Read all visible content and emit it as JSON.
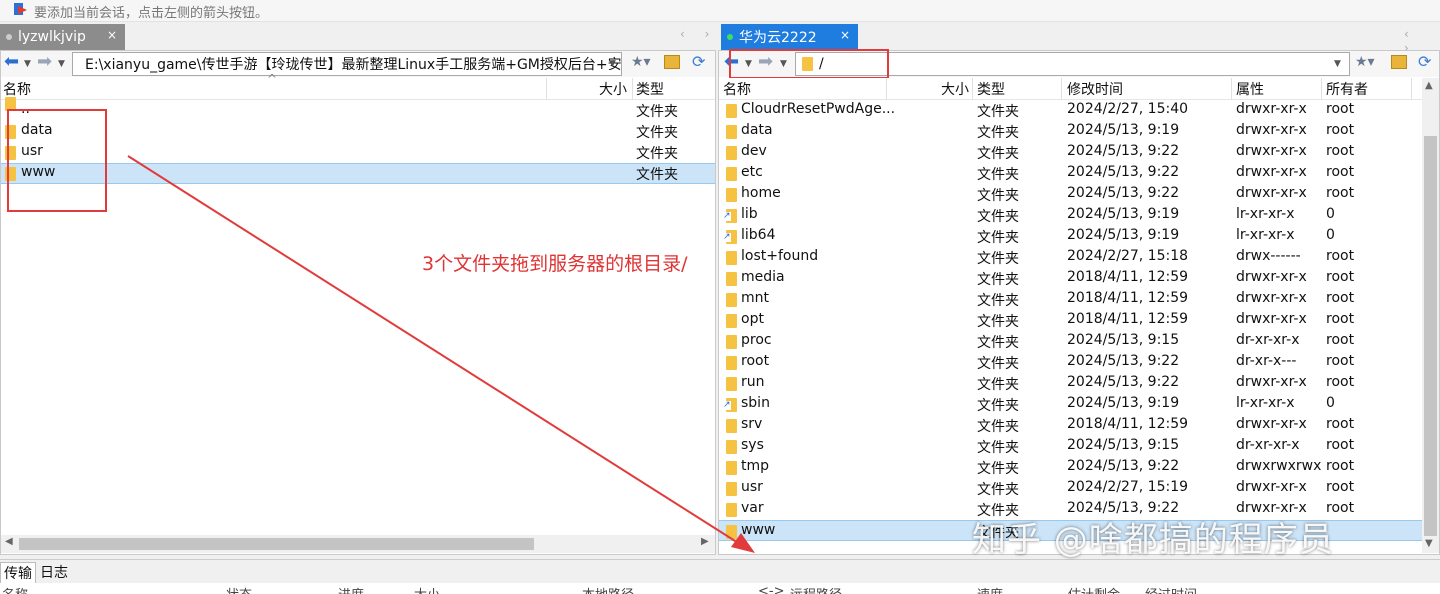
{
  "hint": "要添加当前会话，点击左侧的箭头按钮。",
  "tabs": {
    "left": {
      "label": "lyzwlkjvip",
      "close": "×"
    },
    "right": {
      "label": "华为云2222",
      "close": "×"
    }
  },
  "nav_arrows": "‹ ›",
  "left": {
    "path": "E:\\xianyu_game\\传世手游【玲珑传世】最新整理Linux手工服务端+GM授权后台+安",
    "headers": {
      "name": "名称",
      "size": "大小",
      "type": "类型"
    },
    "rows": [
      {
        "name": "..",
        "type": "文件夹"
      },
      {
        "name": "data",
        "type": "文件夹"
      },
      {
        "name": "usr",
        "type": "文件夹"
      },
      {
        "name": "www",
        "type": "文件夹"
      }
    ]
  },
  "right": {
    "path": "/",
    "headers": {
      "name": "名称",
      "size": "大小",
      "type": "类型",
      "mtime": "修改时间",
      "perm": "属性",
      "owner": "所有者"
    },
    "rows": [
      {
        "name": "CloudrResetPwdAge...",
        "type": "文件夹",
        "mtime": "2024/2/27, 15:40",
        "perm": "drwxr-xr-x",
        "owner": "root"
      },
      {
        "name": "data",
        "type": "文件夹",
        "mtime": "2024/5/13, 9:19",
        "perm": "drwxr-xr-x",
        "owner": "root"
      },
      {
        "name": "dev",
        "type": "文件夹",
        "mtime": "2024/5/13, 9:22",
        "perm": "drwxr-xr-x",
        "owner": "root"
      },
      {
        "name": "etc",
        "type": "文件夹",
        "mtime": "2024/5/13, 9:22",
        "perm": "drwxr-xr-x",
        "owner": "root"
      },
      {
        "name": "home",
        "type": "文件夹",
        "mtime": "2024/5/13, 9:22",
        "perm": "drwxr-xr-x",
        "owner": "root"
      },
      {
        "name": "lib",
        "type": "文件夹",
        "mtime": "2024/5/13, 9:19",
        "perm": "lr-xr-xr-x",
        "owner": "0",
        "link": true
      },
      {
        "name": "lib64",
        "type": "文件夹",
        "mtime": "2024/5/13, 9:19",
        "perm": "lr-xr-xr-x",
        "owner": "0",
        "link": true
      },
      {
        "name": "lost+found",
        "type": "文件夹",
        "mtime": "2024/2/27, 15:18",
        "perm": "drwx------",
        "owner": "root"
      },
      {
        "name": "media",
        "type": "文件夹",
        "mtime": "2018/4/11, 12:59",
        "perm": "drwxr-xr-x",
        "owner": "root"
      },
      {
        "name": "mnt",
        "type": "文件夹",
        "mtime": "2018/4/11, 12:59",
        "perm": "drwxr-xr-x",
        "owner": "root"
      },
      {
        "name": "opt",
        "type": "文件夹",
        "mtime": "2018/4/11, 12:59",
        "perm": "drwxr-xr-x",
        "owner": "root"
      },
      {
        "name": "proc",
        "type": "文件夹",
        "mtime": "2024/5/13, 9:15",
        "perm": "dr-xr-xr-x",
        "owner": "root"
      },
      {
        "name": "root",
        "type": "文件夹",
        "mtime": "2024/5/13, 9:22",
        "perm": "dr-xr-x---",
        "owner": "root"
      },
      {
        "name": "run",
        "type": "文件夹",
        "mtime": "2024/5/13, 9:22",
        "perm": "drwxr-xr-x",
        "owner": "root"
      },
      {
        "name": "sbin",
        "type": "文件夹",
        "mtime": "2024/5/13, 9:19",
        "perm": "lr-xr-xr-x",
        "owner": "0",
        "link": true
      },
      {
        "name": "srv",
        "type": "文件夹",
        "mtime": "2018/4/11, 12:59",
        "perm": "drwxr-xr-x",
        "owner": "root"
      },
      {
        "name": "sys",
        "type": "文件夹",
        "mtime": "2024/5/13, 9:15",
        "perm": "dr-xr-xr-x",
        "owner": "root"
      },
      {
        "name": "tmp",
        "type": "文件夹",
        "mtime": "2024/5/13, 9:22",
        "perm": "drwxrwxrwx",
        "owner": "root"
      },
      {
        "name": "usr",
        "type": "文件夹",
        "mtime": "2024/2/27, 15:19",
        "perm": "drwxr-xr-x",
        "owner": "root"
      },
      {
        "name": "var",
        "type": "文件夹",
        "mtime": "2024/5/13, 9:22",
        "perm": "drwxr-xr-x",
        "owner": "root"
      },
      {
        "name": "www",
        "type": "文件夹",
        "mtime": "",
        "perm": "",
        "owner": ""
      }
    ]
  },
  "annotation": "3个文件夹拖到服务器的根目录/",
  "bottom_tabs": {
    "transfer": "传输",
    "log": "日志"
  },
  "transfer_headers": [
    "名称",
    "状态",
    "进度",
    "大小",
    "本地路径",
    "<->",
    "远程路径",
    "速度",
    "估计剩余",
    "经过时间"
  ],
  "watermark": "知乎 @啥都搞的程序员",
  "colors": {
    "accent": "#1f7de0",
    "selection": "#cce4f7",
    "annotation": "#e13b3b",
    "folder": "#f5c242"
  }
}
